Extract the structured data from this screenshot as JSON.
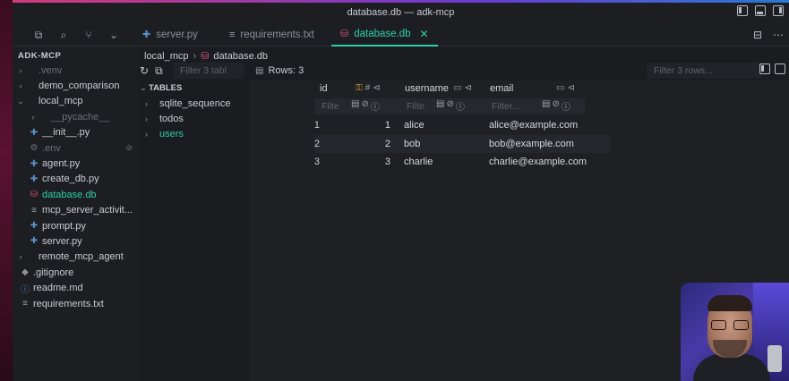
{
  "window": {
    "title": "database.db — adk-mcp"
  },
  "tabs": [
    {
      "label": "server.py",
      "icon": "python-file-icon",
      "active": false
    },
    {
      "label": "requirements.txt",
      "icon": "text-file-icon",
      "active": false
    },
    {
      "label": "database.db",
      "icon": "database-icon",
      "active": true
    }
  ],
  "sidebar": {
    "title": "ADK-MCP",
    "items": [
      {
        "label": ".venv",
        "type": "folder",
        "dim": true
      },
      {
        "label": "demo_comparison",
        "type": "folder"
      },
      {
        "label": "local_mcp",
        "type": "folder-open"
      },
      {
        "label": "__pycache__",
        "type": "folder",
        "dim": true
      },
      {
        "label": "__init__.py",
        "type": "py"
      },
      {
        "label": ".env",
        "type": "gear",
        "dim": true
      },
      {
        "label": "agent.py",
        "type": "py"
      },
      {
        "label": "create_db.py",
        "type": "py"
      },
      {
        "label": "database.db",
        "type": "db",
        "selected": true
      },
      {
        "label": "mcp_server_activit...",
        "type": "txt"
      },
      {
        "label": "prompt.py",
        "type": "py"
      },
      {
        "label": "server.py",
        "type": "py"
      },
      {
        "label": "remote_mcp_agent",
        "type": "folder"
      },
      {
        "label": ".gitignore",
        "type": "git"
      },
      {
        "label": "readme.md",
        "type": "info"
      },
      {
        "label": "requirements.txt",
        "type": "txt"
      }
    ]
  },
  "breadcrumb": {
    "folder": "local_mcp",
    "file": "database.db"
  },
  "toolbar": {
    "filter_tables_placeholder": "Filter 3 tabl",
    "rows_label": "Rows: 3",
    "filter_rows_placeholder": "Filter 3 rows..."
  },
  "tables": {
    "heading": "TABLES",
    "items": [
      {
        "label": "sqlite_sequence"
      },
      {
        "label": "todos"
      },
      {
        "label": "users",
        "selected": true
      }
    ]
  },
  "grid": {
    "columns": [
      {
        "name": "id",
        "filter_placeholder": "Filte"
      },
      {
        "name": "username",
        "filter_placeholder": "Filte"
      },
      {
        "name": "email",
        "filter_placeholder": "Filter..."
      }
    ],
    "rows": [
      {
        "rownum": "1",
        "id": "1",
        "username": "alice",
        "email": "alice@example.com"
      },
      {
        "rownum": "2",
        "id": "2",
        "username": "bob",
        "email": "bob@example.com"
      },
      {
        "rownum": "3",
        "id": "3",
        "username": "charlie",
        "email": "charlie@example.com"
      }
    ]
  },
  "colors": {
    "accent": "#2ecfa8",
    "db_icon": "#e0557a",
    "python_icon": "#5a8fc7",
    "key_icon": "#d9a23a"
  }
}
